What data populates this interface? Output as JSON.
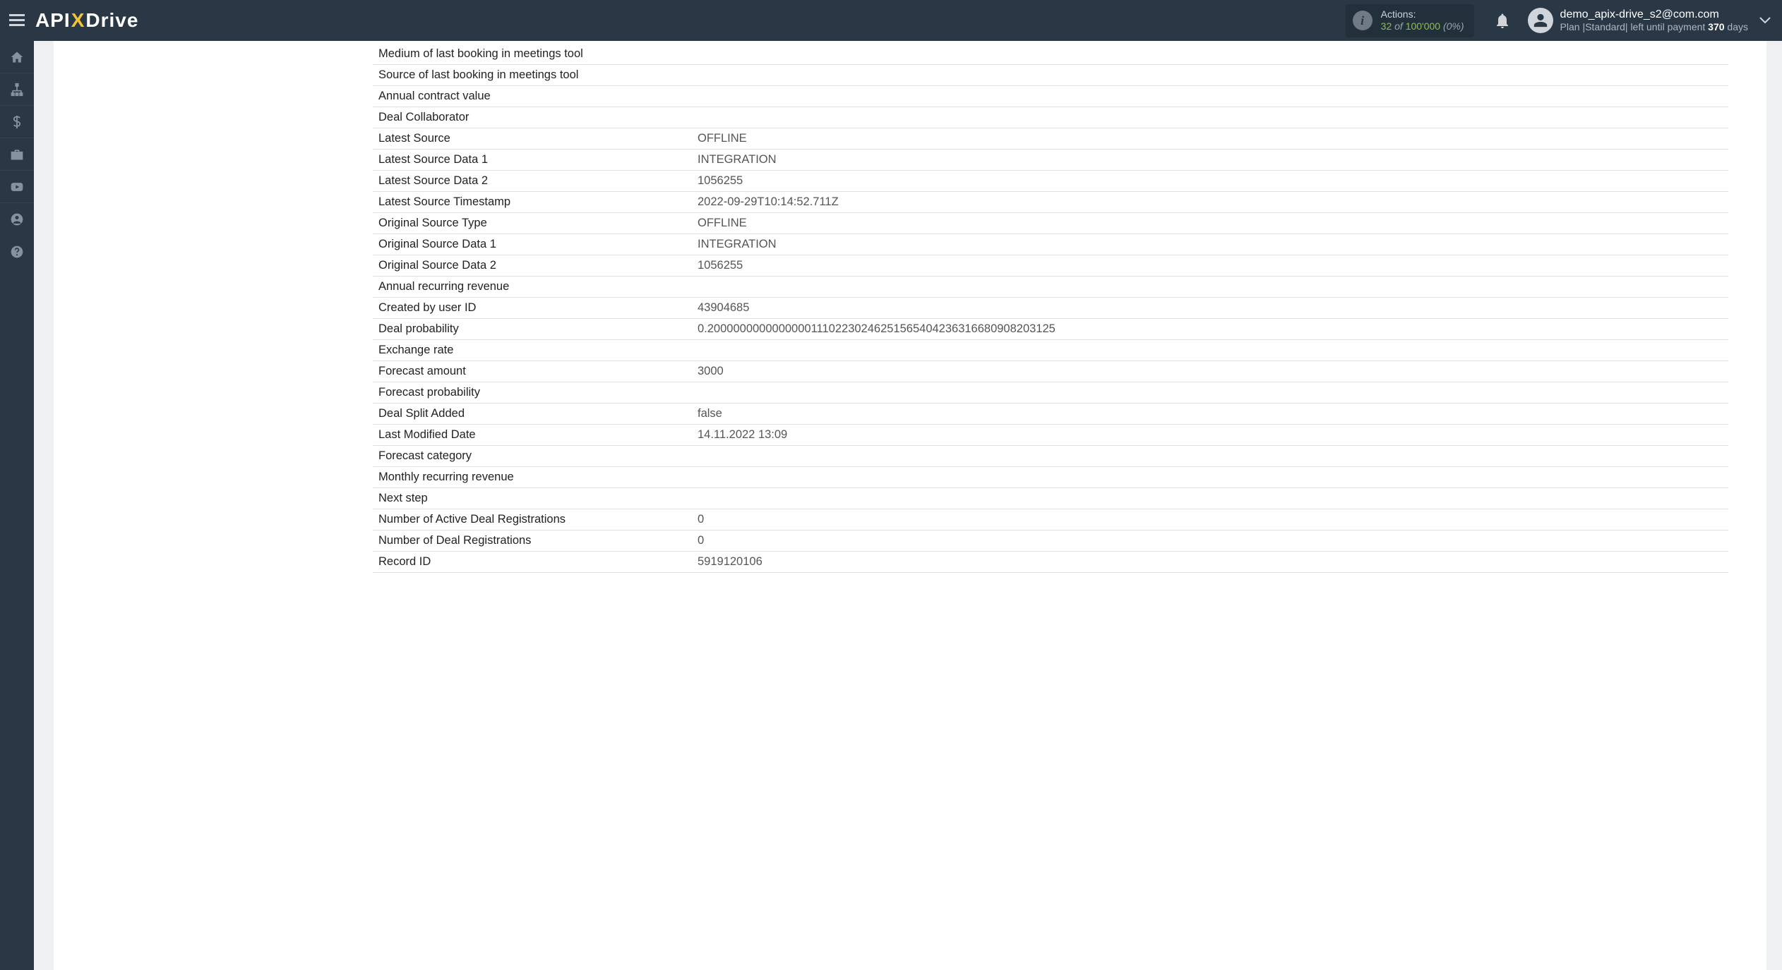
{
  "header": {
    "logo_pre": "API",
    "logo_x": "X",
    "logo_post": "Drive",
    "actions_label": "Actions:",
    "actions_count": "32",
    "actions_of": "of",
    "actions_max": "100'000",
    "actions_pct": "(0%)",
    "user_email": "demo_apix-drive_s2@com.com",
    "plan_prefix": "Plan |",
    "plan_name": "Standard",
    "plan_mid": "| left until payment ",
    "plan_days": "370",
    "plan_suffix": " days"
  },
  "rows": [
    {
      "label": "Medium of last booking in meetings tool",
      "value": ""
    },
    {
      "label": "Source of last booking in meetings tool",
      "value": ""
    },
    {
      "label": "Annual contract value",
      "value": ""
    },
    {
      "label": "Deal Collaborator",
      "value": ""
    },
    {
      "label": "Latest Source",
      "value": "OFFLINE"
    },
    {
      "label": "Latest Source Data 1",
      "value": "INTEGRATION"
    },
    {
      "label": "Latest Source Data 2",
      "value": "1056255"
    },
    {
      "label": "Latest Source Timestamp",
      "value": "2022-09-29T10:14:52.711Z"
    },
    {
      "label": "Original Source Type",
      "value": "OFFLINE"
    },
    {
      "label": "Original Source Data 1",
      "value": "INTEGRATION"
    },
    {
      "label": "Original Source Data 2",
      "value": "1056255"
    },
    {
      "label": "Annual recurring revenue",
      "value": ""
    },
    {
      "label": "Created by user ID",
      "value": "43904685"
    },
    {
      "label": "Deal probability",
      "value": "0.200000000000000011102230246251565404236316680908203125"
    },
    {
      "label": "Exchange rate",
      "value": ""
    },
    {
      "label": "Forecast amount",
      "value": "3000"
    },
    {
      "label": "Forecast probability",
      "value": ""
    },
    {
      "label": "Deal Split Added",
      "value": "false"
    },
    {
      "label": "Last Modified Date",
      "value": "14.11.2022 13:09"
    },
    {
      "label": "Forecast category",
      "value": ""
    },
    {
      "label": "Monthly recurring revenue",
      "value": ""
    },
    {
      "label": "Next step",
      "value": ""
    },
    {
      "label": "Number of Active Deal Registrations",
      "value": "0"
    },
    {
      "label": "Number of Deal Registrations",
      "value": "0"
    },
    {
      "label": "Record ID",
      "value": "5919120106"
    }
  ]
}
